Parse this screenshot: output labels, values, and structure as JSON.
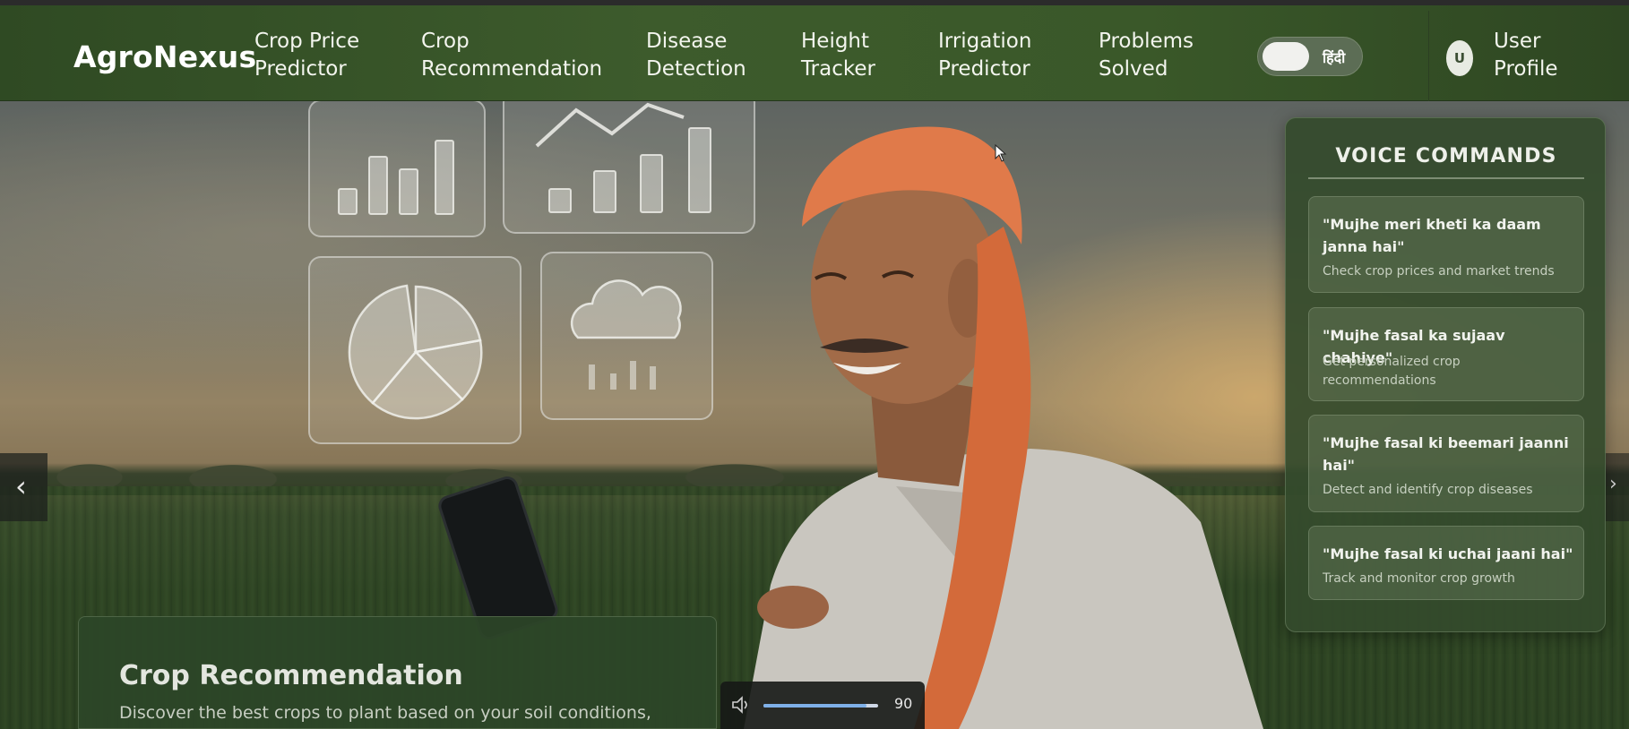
{
  "brand": "AgroNexus",
  "nav": {
    "items": [
      {
        "line1": "Crop Price",
        "line2": "Predictor"
      },
      {
        "line1": "Crop",
        "line2": "Recommendation"
      },
      {
        "line1": "Disease",
        "line2": "Detection"
      },
      {
        "line1": "Height",
        "line2": "Tracker"
      },
      {
        "line1": "Irrigation",
        "line2": "Predictor"
      },
      {
        "line1": "Problems",
        "line2": "Solved"
      }
    ],
    "language_toggle_label": "हिंदी",
    "avatar_initial": "U",
    "profile": {
      "line1": "User",
      "line2": "Profile"
    }
  },
  "voice_commands": {
    "title": "VOICE COMMANDS",
    "items": [
      {
        "command": "\"Mujhe meri kheti ka daam janna hai\"",
        "description": "Check crop prices and market trends"
      },
      {
        "command": "\"Mujhe fasal ka sujaav chahiye\"",
        "description": "Get personalized crop recommendations"
      },
      {
        "command": "\"Mujhe fasal ki beemari jaanni hai\"",
        "description": "Detect and identify crop diseases"
      },
      {
        "command": "\"Mujhe fasal ki uchai jaani hai\"",
        "description": "Track and monitor crop growth"
      }
    ]
  },
  "slide": {
    "title": "Crop Recommendation",
    "description": "Discover the best crops to plant based on your soil conditions,"
  },
  "carousel": {
    "prev_icon": "chevron-left-icon",
    "next_icon": "chevron-right-icon"
  },
  "volume": {
    "icon": "speaker-icon",
    "level": 90,
    "level_text": "90"
  },
  "colors": {
    "nav_green": "#3d5b2c",
    "panel_green": "#344a2c",
    "turban": "#e07a4a",
    "volume_fill": "#7fb0e8"
  }
}
